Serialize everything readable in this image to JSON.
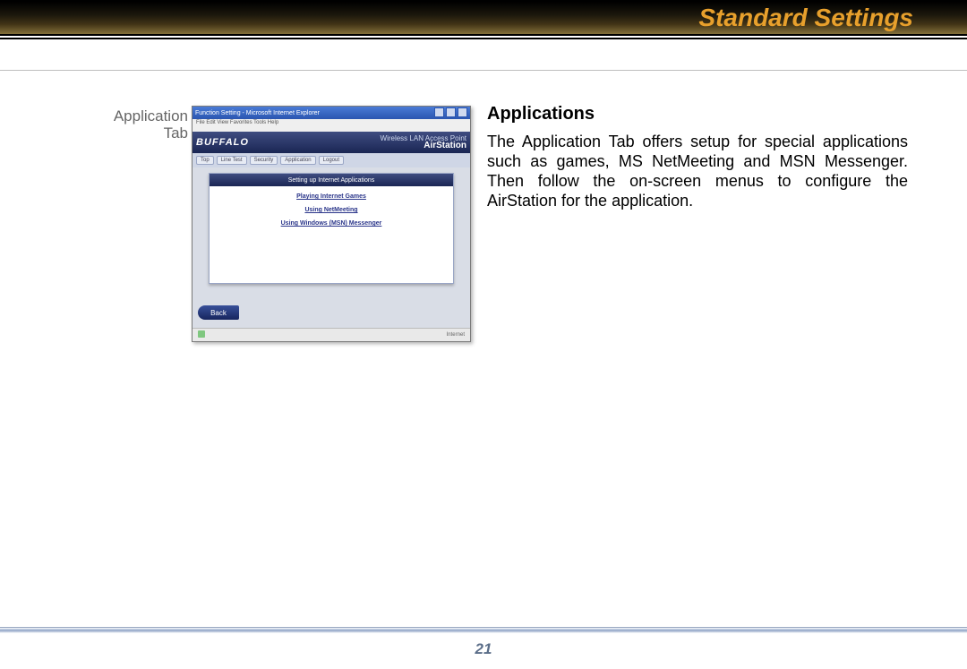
{
  "header": {
    "chapter_title": "Standard Settings"
  },
  "figure": {
    "caption": "Application Tab",
    "window_title": "Function Setting - Microsoft Internet Explorer",
    "menus": "File   Edit   View   Favorites   Tools   Help",
    "brand": "BUFFALO",
    "product_tag": "Wireless LAN Access Point",
    "product_name": "AirStation",
    "tabs": [
      "Top",
      "Line Test",
      "Security",
      "Application",
      "Logout"
    ],
    "panel_header": "Setting up Internet Applications",
    "links": [
      "Playing Internet Games",
      "Using NetMeeting",
      "Using Windows (MSN) Messenger"
    ],
    "back_label": "Back",
    "status_right": "Internet"
  },
  "section": {
    "heading": "Applications",
    "paragraph": "The Application Tab offers setup for special applications such as games, MS NetMeeting and MSN Messenger.  Then follow the on-screen menus to configure the AirStation for the application."
  },
  "footer": {
    "page_number": "21"
  }
}
